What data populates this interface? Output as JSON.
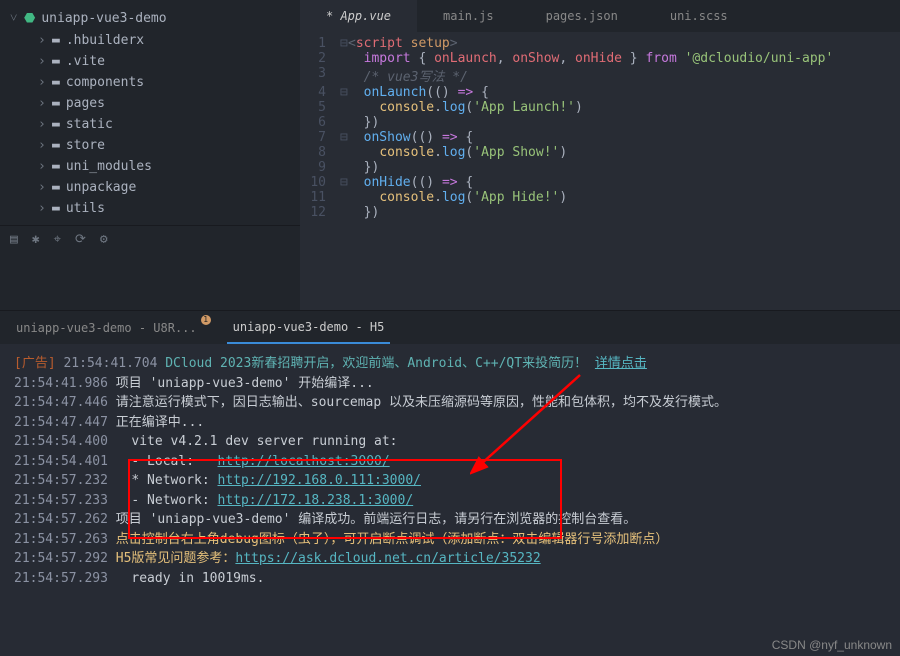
{
  "sidebar": {
    "project": "uniapp-vue3-demo",
    "items": [
      {
        "label": ".hbuilderx"
      },
      {
        "label": ".vite"
      },
      {
        "label": "components"
      },
      {
        "label": "pages"
      },
      {
        "label": "static"
      },
      {
        "label": "store"
      },
      {
        "label": "uni_modules"
      },
      {
        "label": "unpackage"
      },
      {
        "label": "utils"
      }
    ]
  },
  "tabs": [
    {
      "label": "* App.vue"
    },
    {
      "label": "main.js"
    },
    {
      "label": "pages.json"
    },
    {
      "label": "uni.scss"
    }
  ],
  "code": {
    "l1a": "<",
    "l1b": "script",
    "l1c": " setup",
    "l1d": ">",
    "l2a": "import",
    "l2b": " { ",
    "l2c": "onLaunch",
    "l2d": ", ",
    "l2e": "onShow",
    "l2f": ", ",
    "l2g": "onHide",
    "l2h": " } ",
    "l2i": "from",
    "l2j": " '@dcloudio/uni-app'",
    "l3": "/* vue3写法 */",
    "l4a": "onLaunch",
    "l4b": "(() ",
    "l4c": "=>",
    "l4d": " {",
    "l5a": "console",
    "l5b": ".",
    "l5c": "log",
    "l5d": "(",
    "l5e": "'App Launch!'",
    "l5f": ")",
    "l6": "})",
    "l7a": "onShow",
    "l7b": "(() ",
    "l7c": "=>",
    "l7d": " {",
    "l8a": "console",
    "l8b": ".",
    "l8c": "log",
    "l8d": "(",
    "l8e": "'App Show!'",
    "l8f": ")",
    "l9": "})",
    "l10a": "onHide",
    "l10b": "(() ",
    "l10c": "=>",
    "l10d": " {",
    "l11a": "console",
    "l11b": ".",
    "l11c": "log",
    "l11d": "(",
    "l11e": "'App Hide!'",
    "l11f": ")",
    "l12": "})"
  },
  "linenos": [
    "1",
    "2",
    "3",
    "4",
    "5",
    "6",
    "7",
    "8",
    "9",
    "10",
    "11",
    "12"
  ],
  "termtabs": [
    {
      "label": "uniapp-vue3-demo - U8R..."
    },
    {
      "label": "uniapp-vue3-demo - H5"
    }
  ],
  "terminal": {
    "t1a": "[广告]",
    "t1b": " 21:54:41.704 ",
    "t1c": "DCloud 2023新春招聘开启，欢迎前端、Android、C++/QT来投简历！",
    "t1d": "详情点击",
    "t2": "21:54:41.986",
    "t2b": "项目 'uniapp-vue3-demo' 开始编译...",
    "t3": "21:54:47.446",
    "t3b": "请注意运行模式下，因日志输出、sourcemap 以及未压缩源码等原因，性能和包体积，均不及发行模式。",
    "t4": "21:54:47.447",
    "t4b": "正在编译中...",
    "t5": "21:54:54.400",
    "t5b": "  vite v4.2.1 dev server running at:",
    "t6": "21:54:54.401",
    "t6b": "  - Local:   ",
    "t6c": "http://localhost:3000/",
    "t7": "21:54:57.232",
    "t7b": "  * Network: ",
    "t7c": "http://192.168.0.111:3000/",
    "t8": "21:54:57.233",
    "t8b": "  - Network: ",
    "t8c": "http://172.18.238.1:3000/",
    "t9": "21:54:57.262",
    "t9b": "项目 'uniapp-vue3-demo' 编译成功。前端运行日志，请另行在浏览器的控制台查看。",
    "t10": "21:54:57.263",
    "t10b": "点击控制台右上角debug图标（虫子），可开启断点调试（添加断点：双击编辑器行号添加断点）",
    "t11": "21:54:57.292",
    "t11b": "H5版常见问题参考：",
    "t11c": "https://ask.dcloud.net.cn/article/35232",
    "t12": "21:54:57.293",
    "t12b": "  ready in 10019ms."
  },
  "watermark": "CSDN @nyf_unknown"
}
